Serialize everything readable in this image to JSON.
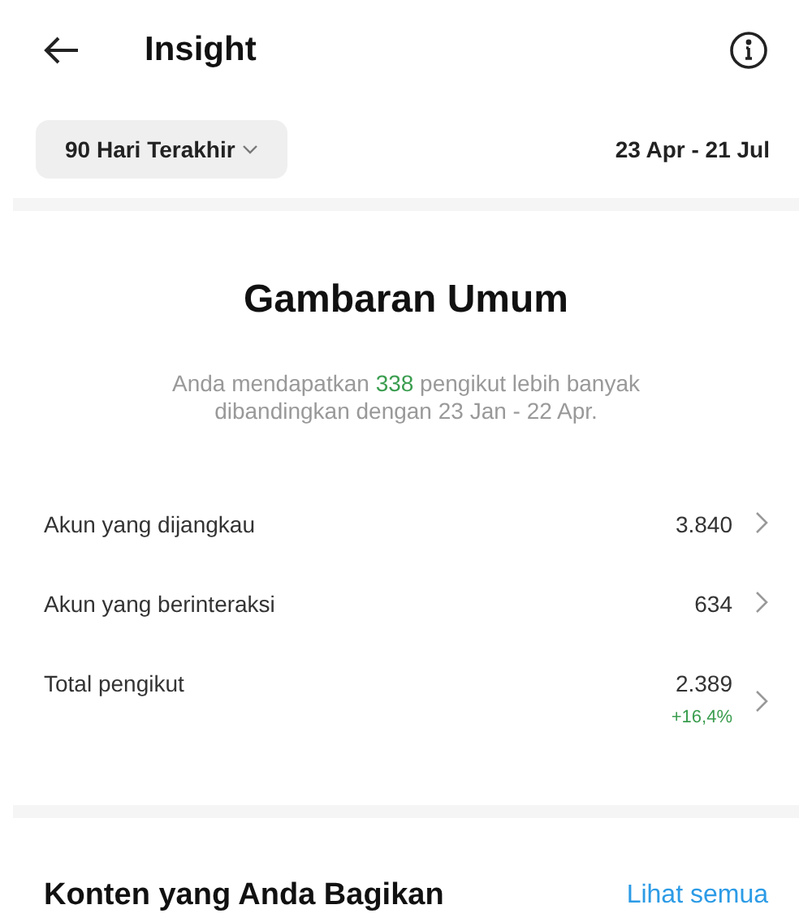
{
  "header": {
    "title": "Insight"
  },
  "filter": {
    "period": "90 Hari Terakhir",
    "range": "23 Apr - 21 Jul"
  },
  "overview": {
    "title": "Gambaran Umum",
    "summary": "Anda mendapatkan **338** pengikut lebih banyak dibandingkan dengan 23 Jan - 22 Apr."
  },
  "metrics": [
    {
      "label": "Akun yang dijangkau",
      "value": "3.840"
    },
    {
      "label": "Akun yang berinteraksi",
      "value": "634"
    },
    {
      "label": "Total pengikut",
      "value": "2.389",
      "change": "+16,4%"
    }
  ],
  "content_section": {
    "title": "Konten yang Anda Bagikan",
    "link": "Lihat semua"
  }
}
